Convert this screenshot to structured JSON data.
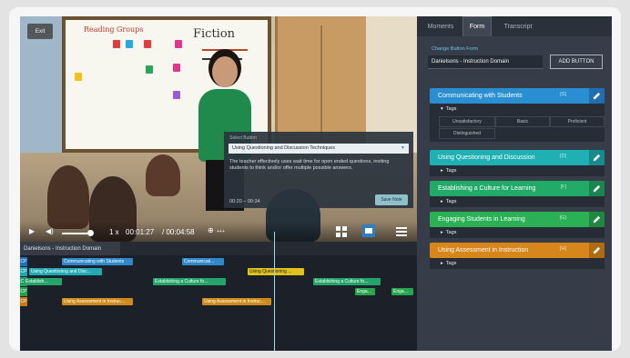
{
  "video": {
    "exit_label": "Exit",
    "board_text_left": "Reading Groups",
    "board_text_right": "Fiction",
    "popup": {
      "heading": "Select Button",
      "selected": "Using Questioning and Discussion Techniques",
      "text": "The teacher effectively uses wait time for open ended questions, inviting students to think and/or offer multiple possible answers.",
      "range": "00:20 – 00:34",
      "save_label": "Save Note"
    },
    "controls": {
      "speed": "1 x",
      "current_time": "00:01:27",
      "total_time": "/ 00:04:58",
      "zoom_suffix": "+++"
    }
  },
  "timeline": {
    "tab_label": "Danielsons - Instruction Domain",
    "rows": [
      {
        "label": "CP",
        "color": "#1f6fbf",
        "clips": [
          {
            "text": "Communicating with Students",
            "color": "#2f88c8"
          },
          {
            "text": "Communicati...",
            "color": "#2f88c8"
          }
        ]
      },
      {
        "label": "CP",
        "color": "#1fa6b3",
        "clips": [
          {
            "text": "Using Questioning and Disc...",
            "color": "#22a9b4"
          },
          {
            "text": "Using Questioning ...",
            "color": "#e0c21a"
          }
        ]
      },
      {
        "label": "CP",
        "color": "#1ea265",
        "clips": [
          {
            "text": "Establish...",
            "color": "#24a46a"
          },
          {
            "text": "Establishing a Culture fo...",
            "color": "#24a46a"
          },
          {
            "text": "Establishing a Culture fo...",
            "color": "#24a46a"
          }
        ]
      },
      {
        "label": "CP",
        "color": "#1ea24a",
        "clips": [
          {
            "text": "Enga...",
            "color": "#25a64d"
          },
          {
            "text": "Enga...",
            "color": "#25a64d"
          }
        ]
      },
      {
        "label": "CP",
        "color": "#c77b12",
        "clips": [
          {
            "text": "Using Assessment in Instruc...",
            "color": "#d08a1a"
          },
          {
            "text": "Using Assessment in Instruc...",
            "color": "#d08a1a"
          }
        ]
      }
    ]
  },
  "panel": {
    "tabs": [
      "Moments",
      "Form",
      "Transcript"
    ],
    "change_label": "Change Button Form",
    "form_select": "Danielsons - Instruction Domain",
    "add_button": "ADD BUTTON",
    "categories": [
      {
        "label": "Communicating with Students",
        "key": "[S]",
        "color": "#2a8fd0",
        "edit_color": "#1f6fb0"
      },
      {
        "label": "Using Questioning and Discussion",
        "key": "[D]",
        "color": "#1fb0b4",
        "edit_color": "#178a8e"
      },
      {
        "label": "Establishing a Culture for Learning",
        "key": "[F]",
        "color": "#22aa68",
        "edit_color": "#18874f"
      },
      {
        "label": "Engaging Students in Learning",
        "key": "[G]",
        "color": "#2ab055",
        "edit_color": "#1d8a40"
      },
      {
        "label": "Using Assessment in Instruction",
        "key": "[H]",
        "color": "#d6861b",
        "edit_color": "#b06a10"
      }
    ],
    "tags_label": "Tags",
    "tag_options": [
      "Unsatisfactory",
      "Basic",
      "Proficient",
      "Distinguished"
    ]
  }
}
